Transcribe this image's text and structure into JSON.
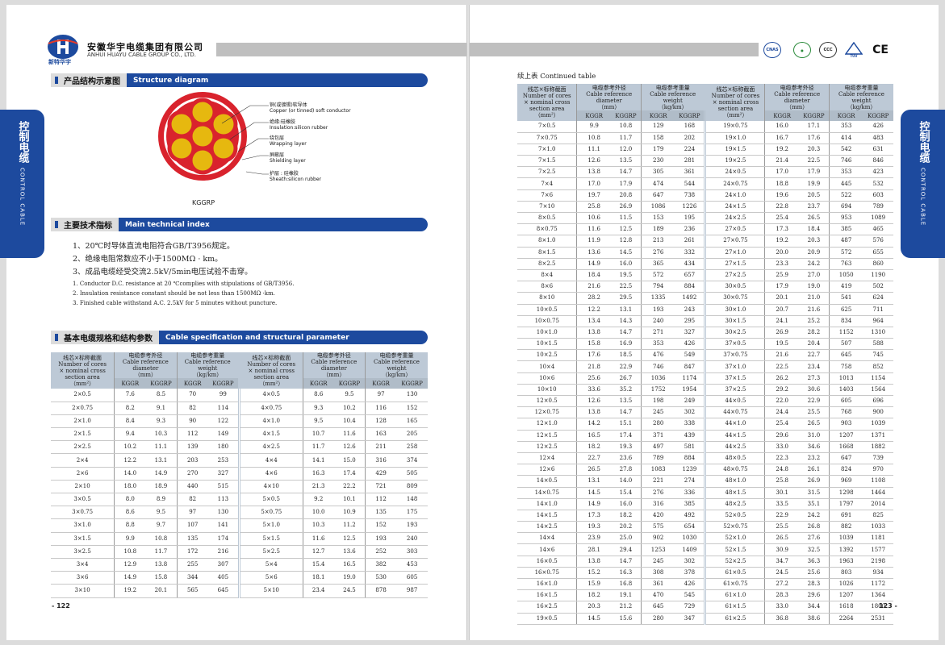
{
  "company": {
    "name_cn": "安徽华宇电缆集团有限公司",
    "name_en": "ANHUI HUAYU CABLE GROUP CO., LTD.",
    "logo_text": "新特华宇"
  },
  "certs": [
    "CNAS",
    "CCC",
    "TUV"
  ],
  "sections": {
    "structure": {
      "cn": "产品结构示意图",
      "en": "Structure diagram"
    },
    "technical": {
      "cn": "主要技术指标",
      "en": "Main technical index"
    },
    "spec": {
      "cn": "基本电缆规格和结构参数",
      "en": "Cable specification and structural parameter"
    }
  },
  "diagram": {
    "model": "KGGRP",
    "layers": [
      {
        "cn": "铜(或镀锡)软导体",
        "en": "Copper (or tinned) soft conductor"
      },
      {
        "cn": "绝缘:硅橡胶",
        "en": "Insulation:silicon rubber"
      },
      {
        "cn": "绕包层",
        "en": "Wrapping layer"
      },
      {
        "cn": "屏蔽层",
        "en": "Shielding layer"
      },
      {
        "cn": "护层 : 硅橡胶",
        "en": "Sheath:silicon rubber"
      }
    ]
  },
  "tech_cn": [
    "1、20℃时导体直流电阻符合GB/T3956规定。",
    "2、绝缘电阻常数应不小于1500MΩ · km。",
    "3、成品电缆经受交流2.5kV/5min电压试验不击穿。"
  ],
  "tech_en": [
    "1. Conductor D.C. resistance at 20 ℃complies with stipulations of GB/T3956.",
    "2. Insulation resistance constant should be not less than 1500MΩ ·km.",
    "3. Finished cable withstand A.C. 2.5kV for 5 minutes without puncture."
  ],
  "side_tab": {
    "cn": "控制电缆",
    "en": "CONTROL CABLE"
  },
  "continued": "续上表 Continued table",
  "table_headers": {
    "col1": [
      "线芯×标称截面",
      "Number of cores",
      "× nominal cross",
      "section area",
      "（mm²）"
    ],
    "col2": [
      "电缆参考外径",
      "Cable reference diameter",
      "（mm）"
    ],
    "col3": [
      "电缆参考重量",
      "Cable reference weight",
      "（kg/km）"
    ],
    "sub": [
      "KGGR",
      "KGGRP",
      "KGGR",
      "KGGRP"
    ]
  },
  "left_table": {
    "a": [
      [
        "2×0.5",
        "7.6",
        "8.5",
        "70",
        "99"
      ],
      [
        "2×0.75",
        "8.2",
        "9.1",
        "82",
        "114"
      ],
      [
        "2×1.0",
        "8.4",
        "9.3",
        "90",
        "122"
      ],
      [
        "2×1.5",
        "9.4",
        "10.3",
        "112",
        "149"
      ],
      [
        "2×2.5",
        "10.2",
        "11.1",
        "139",
        "180"
      ],
      [
        "2×4",
        "12.2",
        "13.1",
        "203",
        "253"
      ],
      [
        "2×6",
        "14.0",
        "14.9",
        "270",
        "327"
      ],
      [
        "2×10",
        "18.0",
        "18.9",
        "440",
        "515"
      ],
      [
        "3×0.5",
        "8.0",
        "8.9",
        "82",
        "113"
      ],
      [
        "3×0.75",
        "8.6",
        "9.5",
        "97",
        "130"
      ],
      [
        "3×1.0",
        "8.8",
        "9.7",
        "107",
        "141"
      ],
      [
        "3×1.5",
        "9.9",
        "10.8",
        "135",
        "174"
      ],
      [
        "3×2.5",
        "10.8",
        "11.7",
        "172",
        "216"
      ],
      [
        "3×4",
        "12.9",
        "13.8",
        "255",
        "307"
      ],
      [
        "3×6",
        "14.9",
        "15.8",
        "344",
        "405"
      ],
      [
        "3×10",
        "19.2",
        "20.1",
        "565",
        "645"
      ]
    ],
    "b": [
      [
        "4×0.5",
        "8.6",
        "9.5",
        "97",
        "130"
      ],
      [
        "4×0.75",
        "9.3",
        "10.2",
        "116",
        "152"
      ],
      [
        "4×1.0",
        "9.5",
        "10.4",
        "128",
        "165"
      ],
      [
        "4×1.5",
        "10.7",
        "11.6",
        "163",
        "205"
      ],
      [
        "4×2.5",
        "11.7",
        "12.6",
        "211",
        "258"
      ],
      [
        "4×4",
        "14.1",
        "15.0",
        "316",
        "374"
      ],
      [
        "4×6",
        "16.3",
        "17.4",
        "429",
        "505"
      ],
      [
        "4×10",
        "21.3",
        "22.2",
        "721",
        "809"
      ],
      [
        "5×0.5",
        "9.2",
        "10.1",
        "112",
        "148"
      ],
      [
        "5×0.75",
        "10.0",
        "10.9",
        "135",
        "175"
      ],
      [
        "5×1.0",
        "10.3",
        "11.2",
        "152",
        "193"
      ],
      [
        "5×1.5",
        "11.6",
        "12.5",
        "193",
        "240"
      ],
      [
        "5×2.5",
        "12.7",
        "13.6",
        "252",
        "303"
      ],
      [
        "5×4",
        "15.4",
        "16.5",
        "382",
        "453"
      ],
      [
        "5×6",
        "18.1",
        "19.0",
        "530",
        "605"
      ],
      [
        "5×10",
        "23.4",
        "24.5",
        "878",
        "987"
      ]
    ]
  },
  "right_table": {
    "a": [
      [
        "7×0.5",
        "9.9",
        "10.8",
        "129",
        "168"
      ],
      [
        "7×0.75",
        "10.8",
        "11.7",
        "158",
        "202"
      ],
      [
        "7×1.0",
        "11.1",
        "12.0",
        "179",
        "224"
      ],
      [
        "7×1.5",
        "12.6",
        "13.5",
        "230",
        "281"
      ],
      [
        "7×2.5",
        "13.8",
        "14.7",
        "305",
        "361"
      ],
      [
        "7×4",
        "17.0",
        "17.9",
        "474",
        "544"
      ],
      [
        "7×6",
        "19.7",
        "20.8",
        "647",
        "738"
      ],
      [
        "7×10",
        "25.8",
        "26.9",
        "1086",
        "1226"
      ],
      [
        "8×0.5",
        "10.6",
        "11.5",
        "153",
        "195"
      ],
      [
        "8×0.75",
        "11.6",
        "12.5",
        "189",
        "236"
      ],
      [
        "8×1.0",
        "11.9",
        "12.8",
        "213",
        "261"
      ],
      [
        "8×1.5",
        "13.6",
        "14.5",
        "276",
        "332"
      ],
      [
        "8×2.5",
        "14.9",
        "16.0",
        "365",
        "434"
      ],
      [
        "8×4",
        "18.4",
        "19.5",
        "572",
        "657"
      ],
      [
        "8×6",
        "21.6",
        "22.5",
        "794",
        "884"
      ],
      [
        "8×10",
        "28.2",
        "29.5",
        "1335",
        "1492"
      ],
      [
        "10×0.5",
        "12.2",
        "13.1",
        "193",
        "243"
      ],
      [
        "10×0.75",
        "13.4",
        "14.3",
        "240",
        "295"
      ],
      [
        "10×1.0",
        "13.8",
        "14.7",
        "271",
        "327"
      ],
      [
        "10×1.5",
        "15.8",
        "16.9",
        "353",
        "426"
      ],
      [
        "10×2.5",
        "17.6",
        "18.5",
        "476",
        "549"
      ],
      [
        "10×4",
        "21.8",
        "22.9",
        "746",
        "847"
      ],
      [
        "10×6",
        "25.6",
        "26.7",
        "1036",
        "1174"
      ],
      [
        "10×10",
        "33.6",
        "35.2",
        "1752",
        "1954"
      ],
      [
        "12×0.5",
        "12.6",
        "13.5",
        "198",
        "249"
      ],
      [
        "12×0.75",
        "13.8",
        "14.7",
        "245",
        "302"
      ],
      [
        "12×1.0",
        "14.2",
        "15.1",
        "280",
        "338"
      ],
      [
        "12×1.5",
        "16.5",
        "17.4",
        "371",
        "439"
      ],
      [
        "12×2.5",
        "18.2",
        "19.3",
        "497",
        "581"
      ],
      [
        "12×4",
        "22.7",
        "23.6",
        "789",
        "884"
      ],
      [
        "12×6",
        "26.5",
        "27.8",
        "1083",
        "1239"
      ],
      [
        "14×0.5",
        "13.1",
        "14.0",
        "221",
        "274"
      ],
      [
        "14×0.75",
        "14.5",
        "15.4",
        "276",
        "336"
      ],
      [
        "14×1.0",
        "14.9",
        "16.0",
        "316",
        "385"
      ],
      [
        "14×1.5",
        "17.3",
        "18.2",
        "420",
        "492"
      ],
      [
        "14×2.5",
        "19.3",
        "20.2",
        "575",
        "654"
      ],
      [
        "14×4",
        "23.9",
        "25.0",
        "902",
        "1030"
      ],
      [
        "14×6",
        "28.1",
        "29.4",
        "1253",
        "1409"
      ],
      [
        "16×0.5",
        "13.8",
        "14.7",
        "245",
        "302"
      ],
      [
        "16×0.75",
        "15.2",
        "16.3",
        "308",
        "378"
      ],
      [
        "16×1.0",
        "15.9",
        "16.8",
        "361",
        "426"
      ],
      [
        "16×1.5",
        "18.2",
        "19.1",
        "470",
        "545"
      ],
      [
        "16×2.5",
        "20.3",
        "21.2",
        "645",
        "729"
      ],
      [
        "19×0.5",
        "14.5",
        "15.6",
        "280",
        "347"
      ]
    ],
    "b": [
      [
        "19×0.75",
        "16.0",
        "17.1",
        "353",
        "426"
      ],
      [
        "19×1.0",
        "16.7",
        "17.6",
        "414",
        "483"
      ],
      [
        "19×1.5",
        "19.2",
        "20.3",
        "542",
        "631"
      ],
      [
        "19×2.5",
        "21.4",
        "22.5",
        "746",
        "846"
      ],
      [
        "24×0.5",
        "17.0",
        "17.9",
        "353",
        "423"
      ],
      [
        "24×0.75",
        "18.8",
        "19.9",
        "445",
        "532"
      ],
      [
        "24×1.0",
        "19.6",
        "20.5",
        "522",
        "603"
      ],
      [
        "24×1.5",
        "22.8",
        "23.7",
        "694",
        "789"
      ],
      [
        "24×2.5",
        "25.4",
        "26.5",
        "953",
        "1089"
      ],
      [
        "27×0.5",
        "17.3",
        "18.4",
        "385",
        "465"
      ],
      [
        "27×0.75",
        "19.2",
        "20.3",
        "487",
        "576"
      ],
      [
        "27×1.0",
        "20.0",
        "20.9",
        "572",
        "655"
      ],
      [
        "27×1.5",
        "23.3",
        "24.2",
        "763",
        "860"
      ],
      [
        "27×2.5",
        "25.9",
        "27.0",
        "1050",
        "1190"
      ],
      [
        "30×0.5",
        "17.9",
        "19.0",
        "419",
        "502"
      ],
      [
        "30×0.75",
        "20.1",
        "21.0",
        "541",
        "624"
      ],
      [
        "30×1.0",
        "20.7",
        "21.6",
        "625",
        "711"
      ],
      [
        "30×1.5",
        "24.1",
        "25.2",
        "834",
        "964"
      ],
      [
        "30×2.5",
        "26.9",
        "28.2",
        "1152",
        "1310"
      ],
      [
        "37×0.5",
        "19.5",
        "20.4",
        "507",
        "588"
      ],
      [
        "37×0.75",
        "21.6",
        "22.7",
        "645",
        "745"
      ],
      [
        "37×1.0",
        "22.5",
        "23.4",
        "758",
        "852"
      ],
      [
        "37×1.5",
        "26.2",
        "27.3",
        "1013",
        "1154"
      ],
      [
        "37×2.5",
        "29.2",
        "30.6",
        "1403",
        "1564"
      ],
      [
        "44×0.5",
        "22.0",
        "22.9",
        "605",
        "696"
      ],
      [
        "44×0.75",
        "24.4",
        "25.5",
        "768",
        "900"
      ],
      [
        "44×1.0",
        "25.4",
        "26.5",
        "903",
        "1039"
      ],
      [
        "44×1.5",
        "29.6",
        "31.0",
        "1207",
        "1371"
      ],
      [
        "44×2.5",
        "33.0",
        "34.6",
        "1668",
        "1882"
      ],
      [
        "48×0.5",
        "22.3",
        "23.2",
        "647",
        "739"
      ],
      [
        "48×0.75",
        "24.8",
        "26.1",
        "824",
        "970"
      ],
      [
        "48×1.0",
        "25.8",
        "26.9",
        "969",
        "1108"
      ],
      [
        "48×1.5",
        "30.1",
        "31.5",
        "1298",
        "1464"
      ],
      [
        "48×2.5",
        "33.5",
        "35.1",
        "1797",
        "2014"
      ],
      [
        "52×0.5",
        "22.9",
        "24.2",
        "691",
        "825"
      ],
      [
        "52×0.75",
        "25.5",
        "26.8",
        "882",
        "1033"
      ],
      [
        "52×1.0",
        "26.5",
        "27.6",
        "1039",
        "1181"
      ],
      [
        "52×1.5",
        "30.9",
        "32.5",
        "1392",
        "1577"
      ],
      [
        "52×2.5",
        "34.7",
        "36.3",
        "1963",
        "2198"
      ],
      [
        "61×0.5",
        "24.5",
        "25.6",
        "803",
        "934"
      ],
      [
        "61×0.75",
        "27.2",
        "28.3",
        "1026",
        "1172"
      ],
      [
        "61×1.0",
        "28.3",
        "29.6",
        "1207",
        "1364"
      ],
      [
        "61×1.5",
        "33.0",
        "34.4",
        "1618",
        "1800"
      ],
      [
        "61×2.5",
        "36.8",
        "38.6",
        "2264",
        "2531"
      ]
    ]
  },
  "pages": {
    "left": "- 122",
    "right": "123 -"
  }
}
